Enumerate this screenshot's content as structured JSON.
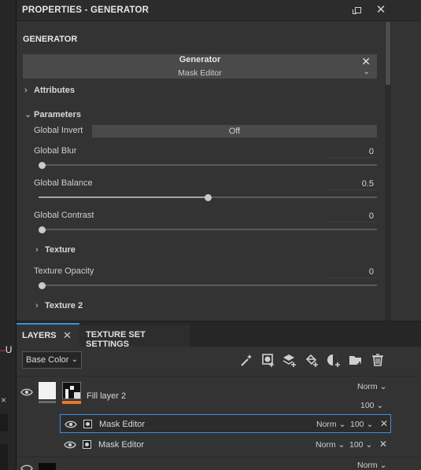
{
  "left_panel": {
    "fragment_text": "U",
    "close_glyph": "×"
  },
  "properties": {
    "title": "PROPERTIES - GENERATOR",
    "section": "GENERATOR",
    "generator_name": "Generator",
    "generator_sub": "Mask Editor",
    "groups": {
      "attributes": "Attributes",
      "parameters": "Parameters",
      "texture": "Texture",
      "texture2": "Texture 2"
    },
    "params": {
      "global_invert": {
        "label": "Global Invert",
        "value": "Off"
      },
      "global_blur": {
        "label": "Global Blur",
        "value": "0",
        "fraction": 0
      },
      "global_balance": {
        "label": "Global Balance",
        "value": "0.5",
        "fraction": 0.5
      },
      "global_contrast": {
        "label": "Global Contrast",
        "value": "0",
        "fraction": 0
      },
      "texture_opacity": {
        "label": "Texture Opacity",
        "value": "0",
        "fraction": 0
      }
    }
  },
  "layers": {
    "tabs": {
      "layers": "LAYERS",
      "texture_set_settings": "TEXTURE SET SETTINGS"
    },
    "channel": "Base Color",
    "tool_icons": [
      "magic-wand-icon",
      "add-mask-icon",
      "add-layer-icon",
      "add-fill-icon",
      "smart-material-icon",
      "add-folder-icon",
      "delete-icon"
    ],
    "fill_layer": {
      "name": "Fill layer 2",
      "blend": "Norm",
      "opacity": "100"
    },
    "effects": [
      {
        "name": "Mask Editor",
        "blend": "Norm",
        "opacity": "100",
        "selected": true
      },
      {
        "name": "Mask Editor",
        "blend": "Norm",
        "opacity": "100",
        "selected": false
      }
    ],
    "next_layer": {
      "blend": "Norm"
    }
  },
  "colors": {
    "accent": "#3d8fe0",
    "fill_layer_marker": "#e07a2e",
    "panel": "#333333"
  }
}
